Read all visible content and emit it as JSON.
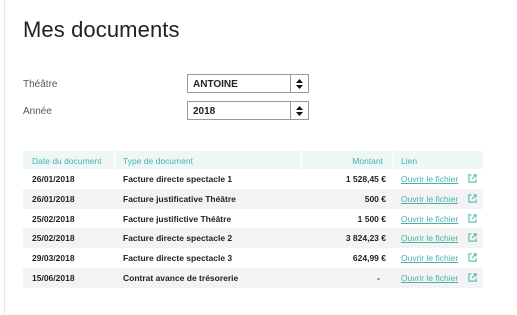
{
  "page": {
    "title": "Mes documents"
  },
  "filters": {
    "theatre": {
      "label": "Théâtre",
      "value": "ANTOINE"
    },
    "annee": {
      "label": "Année",
      "value": "2018"
    }
  },
  "table": {
    "headers": {
      "date": "Date du document",
      "type": "Type de document",
      "montant": "Montant",
      "lien": "Lien"
    },
    "rows": [
      {
        "date": "26/01/2018",
        "type": "Facture directe spectacle 1",
        "montant": "1 528,45 €",
        "lien": "Ouvrir le fichier"
      },
      {
        "date": "26/01/2018",
        "type": "Facture justificative Théâtre",
        "montant": "500 €",
        "lien": "Ouvrir le fichier"
      },
      {
        "date": "25/02/2018",
        "type": "Facture justifictive Théâtre",
        "montant": "1 500 €",
        "lien": "Ouvrir le fichier"
      },
      {
        "date": "25/02/2018",
        "type": "Facture directe spectacle 2",
        "montant": "3 824,23 €",
        "lien": "Ouvrir le fichier"
      },
      {
        "date": "29/03/2018",
        "type": "Facture directe spectacle 3",
        "montant": "624,99 €",
        "lien": "Ouvrir le fichier"
      },
      {
        "date": "15/06/2018",
        "type": "Contrat avance de trésorerie",
        "montant": "-",
        "lien": "Ouvrir le fichier"
      }
    ]
  },
  "colors": {
    "accent": "#45b3a9",
    "header_bg": "#eef7f6",
    "stripe": "#f3f3f3"
  },
  "icons": {
    "sort": "sort-arrows-icon",
    "external": "external-link-icon"
  }
}
